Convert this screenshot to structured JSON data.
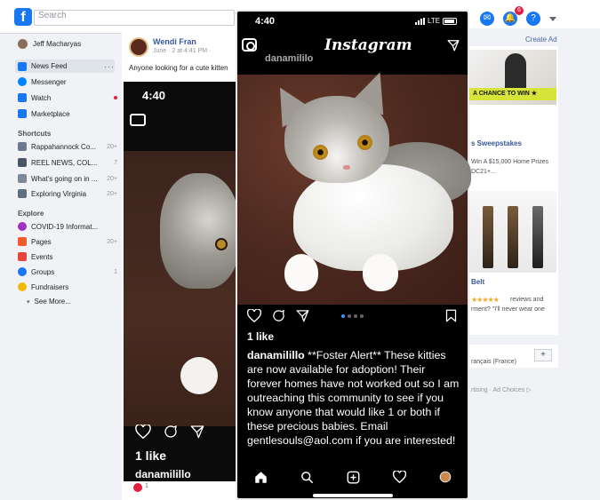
{
  "facebook": {
    "search_placeholder": "Search",
    "notification_count": "6",
    "sidebar": {
      "profile_name": "Jeff Macharyas",
      "items": [
        {
          "label": "News Feed",
          "count": "",
          "icon_color": "#1877f2"
        },
        {
          "label": "Messenger",
          "count": "",
          "icon_color": "#0084ff"
        },
        {
          "label": "Watch",
          "count": "",
          "icon_color": "#1877f2"
        },
        {
          "label": "Marketplace",
          "count": "",
          "icon_color": "#1877f2"
        }
      ],
      "shortcuts_heading": "Shortcuts",
      "shortcuts": [
        {
          "label": "Rappahannock Co...",
          "count": "20+"
        },
        {
          "label": "REEL NEWS, COL...",
          "count": "7"
        },
        {
          "label": "What's going on in ...",
          "count": "20+"
        },
        {
          "label": "Exploring Virginia",
          "count": "20+"
        }
      ],
      "explore_heading": "Explore",
      "explore": [
        {
          "label": "COVID-19 Informat...",
          "count": ""
        },
        {
          "label": "Pages",
          "count": "20+"
        },
        {
          "label": "Events",
          "count": ""
        },
        {
          "label": "Groups",
          "count": "1"
        },
        {
          "label": "Fundraisers",
          "count": ""
        }
      ],
      "see_more": "See More..."
    },
    "post": {
      "author": "Wendi Fran",
      "date": "June · 2 at 4:41 PM · ",
      "text": "Anyone looking for a cute kitten",
      "reaction_count": "1"
    },
    "right_column": {
      "create_ad": "Create Ad",
      "ad1_banner": "A CHANCE TO WIN",
      "ad1_title": "s Sweepstakes",
      "ad1_desc": "Win A $15,000 Home Prizes DC21+...",
      "ad2_title": "Belt",
      "ad2_stars": "★★★★★",
      "ad2_desc_a": "reviews and",
      "ad2_desc_b": "rment? \"I'll never wear one",
      "language": "rançais (France)",
      "language_add": "+",
      "footer": "rtising · Ad Choices ▷"
    }
  },
  "instagram": {
    "status_time": "4:40",
    "network": "LTE",
    "logo": "Instagram",
    "username_partial": "danamililo",
    "likes": "1 like",
    "caption_user": "danamilillo",
    "caption_text": " **Foster Alert** These kitties are now available for adoption! Their forever homes have not worked out so I am outreaching this community to see if you know anyone that would like 1 or both if these precious babies. Email gentlesouls@aol.com if you are interested!",
    "background_copy": {
      "time": "4:40",
      "likes": "1 like",
      "username": "danamilillo"
    },
    "carousel_dots": 4,
    "carousel_active": 1
  },
  "colors": {
    "fb_blue": "#1877f2",
    "ig_black": "#000000",
    "link_blue": "#365899"
  }
}
